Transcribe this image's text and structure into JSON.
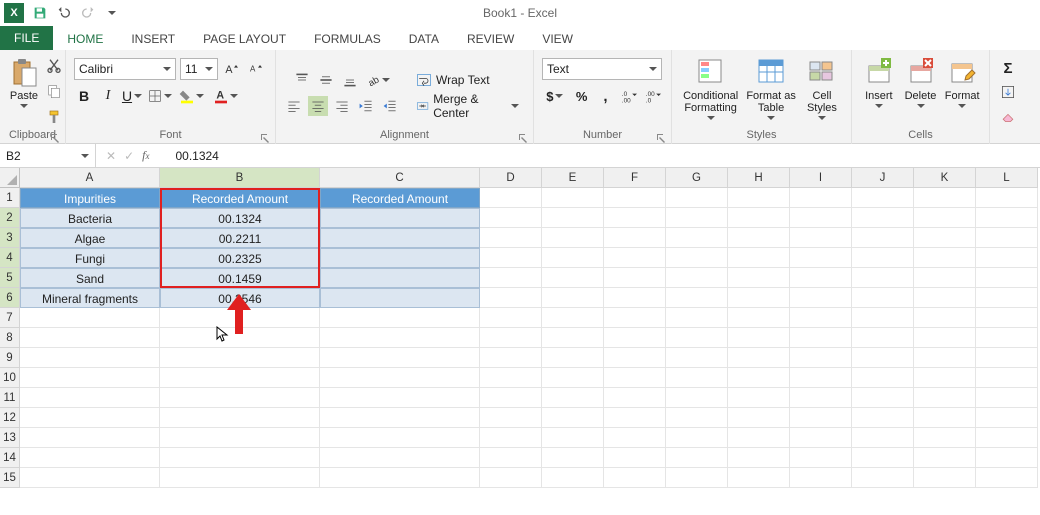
{
  "title": "Book1 - Excel",
  "tabs": {
    "file": "FILE",
    "list": [
      "HOME",
      "INSERT",
      "PAGE LAYOUT",
      "FORMULAS",
      "DATA",
      "REVIEW",
      "VIEW"
    ],
    "active": 0
  },
  "ribbon": {
    "clipboard": {
      "label": "Clipboard",
      "paste": "Paste"
    },
    "font": {
      "label": "Font",
      "name": "Calibri",
      "size": "11"
    },
    "alignment": {
      "label": "Alignment",
      "wrap": "Wrap Text",
      "merge": "Merge & Center"
    },
    "number": {
      "label": "Number",
      "format": "Text"
    },
    "styles": {
      "label": "Styles",
      "cond": "Conditional Formatting",
      "table": "Format as Table",
      "cell": "Cell Styles"
    },
    "cells": {
      "label": "Cells",
      "insert": "Insert",
      "delete": "Delete",
      "format": "Format"
    }
  },
  "namebox": "B2",
  "formula": "00.1324",
  "columns": [
    "A",
    "B",
    "C",
    "D",
    "E",
    "F",
    "G",
    "H",
    "I",
    "J",
    "K",
    "L"
  ],
  "rowCount": 15,
  "table": {
    "headers": [
      "Impurities",
      "Recorded Amount",
      "Recorded Amount"
    ],
    "rows": [
      [
        "Bacteria",
        "00.1324",
        ""
      ],
      [
        "Algae",
        "00.2211",
        ""
      ],
      [
        "Fungi",
        "00.2325",
        ""
      ],
      [
        "Sand",
        "00.1459",
        ""
      ],
      [
        "Mineral fragments",
        "00.2546",
        ""
      ]
    ]
  },
  "selection": {
    "top_row": 2,
    "bottom_row": 6,
    "col": "B"
  }
}
